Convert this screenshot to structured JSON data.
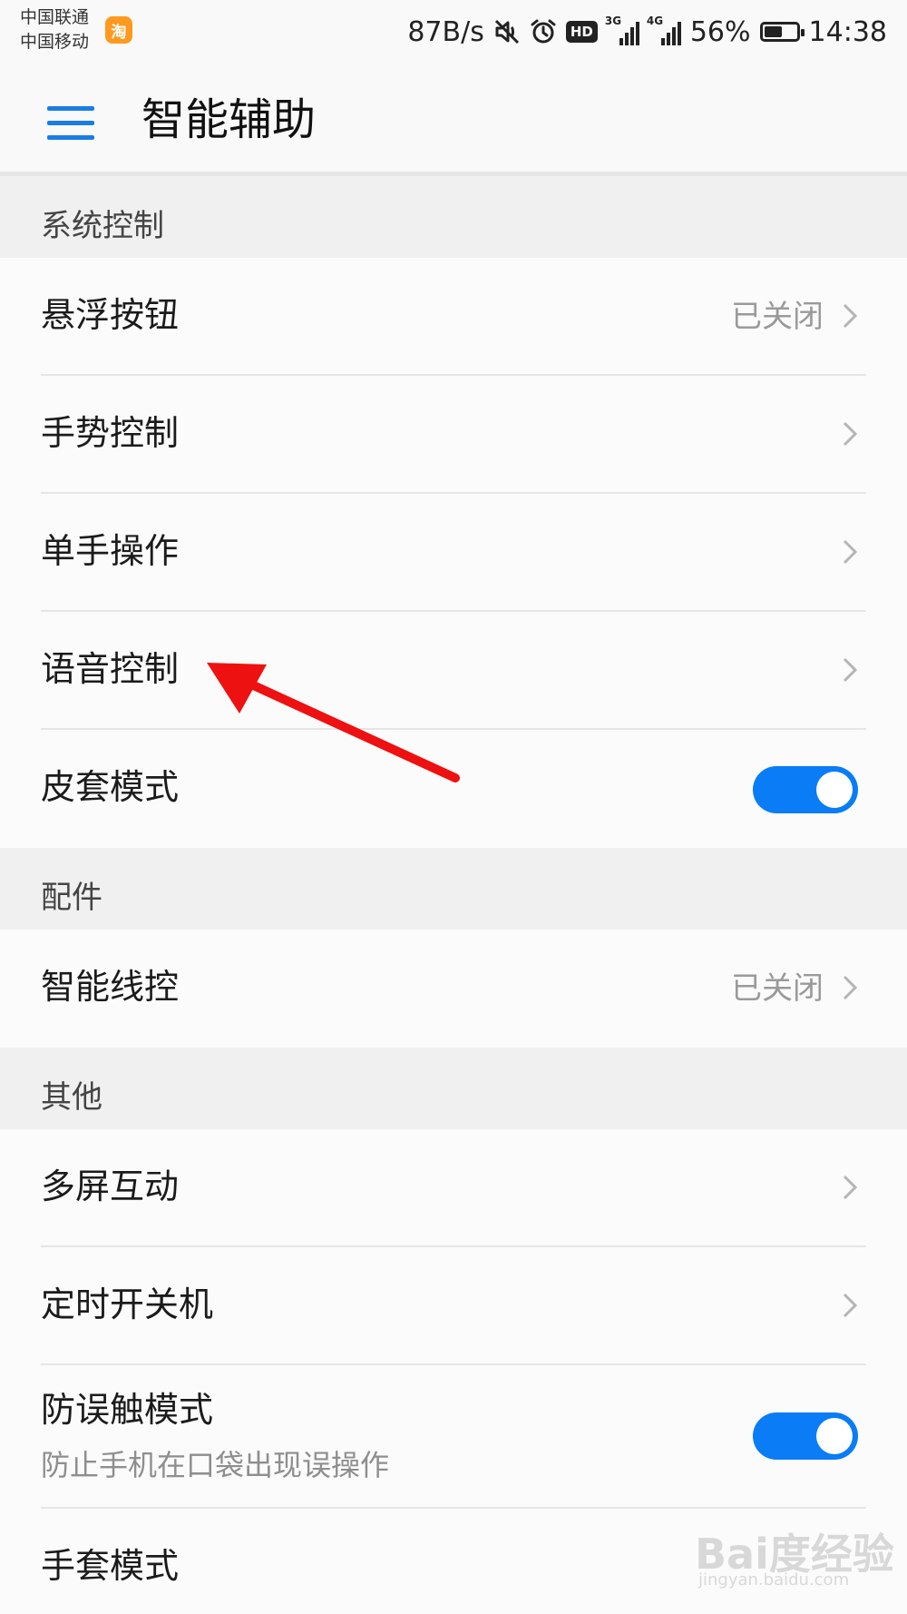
{
  "status_bar": {
    "carrier_1": "中国联通",
    "carrier_2": "中国移动",
    "taobao_glyph": "淘",
    "net_speed": "87B/s",
    "hd": "HD",
    "signal_1_tag": "3G",
    "signal_2_tag": "4G",
    "battery_percent": "56%",
    "battery_level": 0.56,
    "time": "14:38",
    "icons": [
      "taobao-icon",
      "mute-icon",
      "alarm-icon",
      "hd-icon",
      "signal-3g-icon",
      "signal-4g-icon",
      "battery-icon"
    ]
  },
  "app_bar": {
    "title": "智能辅助",
    "menu_icon": "hamburger-menu-icon"
  },
  "sections": {
    "system_control": {
      "header": "系统控制",
      "items": {
        "floating_button": {
          "label": "悬浮按钮",
          "value": "已关闭"
        },
        "gesture_control": {
          "label": "手势控制"
        },
        "one_hand": {
          "label": "单手操作"
        },
        "voice_control": {
          "label": "语音控制"
        },
        "cover_mode": {
          "label": "皮套模式",
          "toggle_on": true
        }
      }
    },
    "accessories": {
      "header": "配件",
      "items": {
        "smart_wire": {
          "label": "智能线控",
          "value": "已关闭"
        }
      }
    },
    "other": {
      "header": "其他",
      "items": {
        "multi_screen": {
          "label": "多屏互动"
        },
        "scheduled_power": {
          "label": "定时开关机"
        },
        "pocket_mode": {
          "label": "防误触模式",
          "sublabel": "防止手机在口袋出现误操作",
          "toggle_on": true
        },
        "glove_mode": {
          "label": "手套模式"
        }
      }
    }
  },
  "colors": {
    "accent": "#0a7cf5",
    "menu_icon": "#1a7de3",
    "arrow": "#ee1111",
    "section_bg": "#f0f0f0"
  },
  "watermark": {
    "logo": "Bai度经验",
    "url": "jingyan.baidu.com"
  }
}
